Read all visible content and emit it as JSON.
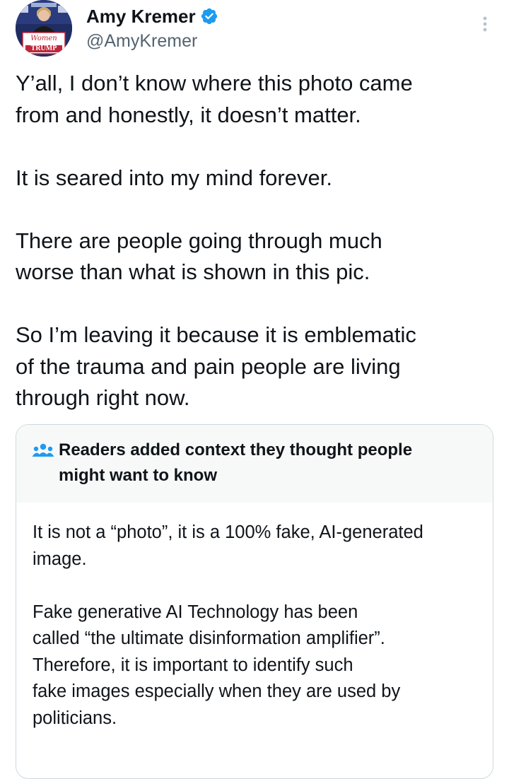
{
  "author": {
    "display_name": "Amy Kremer",
    "handle": "@AmyKremer",
    "verified": true,
    "avatar_icon": "profile-photo",
    "avatar_sign_line1": "Women",
    "avatar_sign_line2": "TRUMP"
  },
  "tweet": {
    "paragraphs": [
      "Y’all, I don’t know where this photo came\nfrom and honestly, it doesn’t matter.",
      "It is seared into my mind forever.",
      "There are people going through much\nworse than what is shown in this pic.",
      "So I’m leaving it because it is emblematic\nof the trauma and pain people are living\nthrough right now."
    ]
  },
  "community_note": {
    "icon": "people-group-icon",
    "title": "Readers added context they thought people\nmight want to know",
    "paragraphs": [
      "It is not a “photo”, it is a 100% fake, AI-generated\nimage.",
      "Fake generative AI Technology has been\ncalled “the ultimate disinformation amplifier”.\nTherefore, it is important to identify such\nfake images especially when they are used by\npoliticians."
    ]
  },
  "colors": {
    "text_primary": "#0f1419",
    "text_secondary": "#536471",
    "verified_blue": "#1d9bf0",
    "note_header_bg": "#f7f9f9",
    "border": "#cfd9de"
  }
}
